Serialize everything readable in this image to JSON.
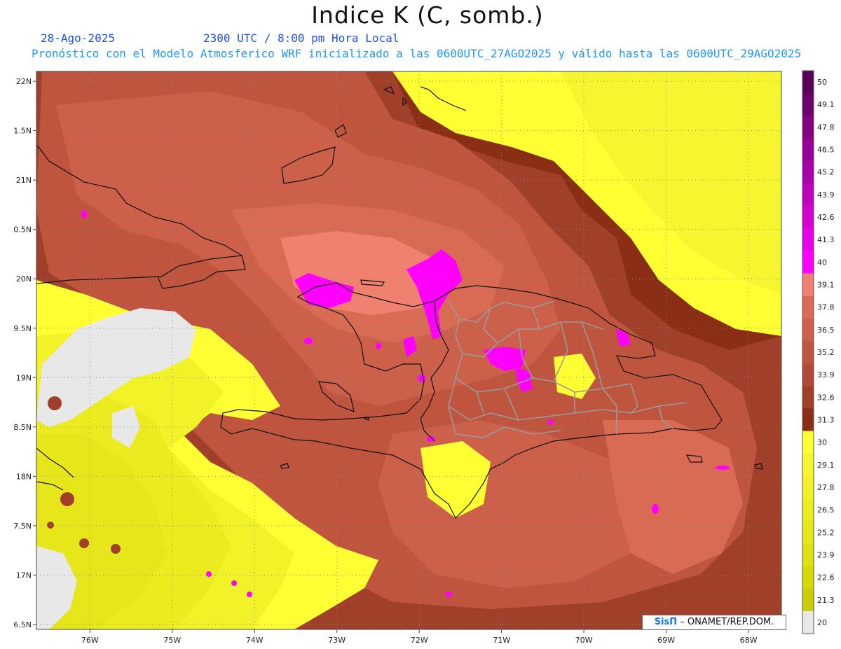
{
  "header": {
    "title": "Indice K (C, somb.)",
    "date": "28-Ago-2025",
    "time": "2300 UTC / 8:00 pm Hora Local",
    "description": "Pronóstico con el Modelo Atmosferico WRF inicializado a las 0600UTC_27AGO2025 y válido hasta las  0600UTC_29AGO2025"
  },
  "map": {
    "lon_range": [
      -76.65,
      -67.6
    ],
    "lat_range": [
      16.45,
      22.1
    ],
    "lat_ticks": [
      {
        "value": 22.0,
        "label": "22N"
      },
      {
        "value": 21.5,
        "label": "1.5N"
      },
      {
        "value": 21.0,
        "label": "21N"
      },
      {
        "value": 20.5,
        "label": "0.5N"
      },
      {
        "value": 20.0,
        "label": "20N"
      },
      {
        "value": 19.5,
        "label": "9.5N"
      },
      {
        "value": 19.0,
        "label": "19N"
      },
      {
        "value": 18.5,
        "label": "8.5N"
      },
      {
        "value": 18.0,
        "label": "18N"
      },
      {
        "value": 17.5,
        "label": "7.5N"
      },
      {
        "value": 17.0,
        "label": "17N"
      },
      {
        "value": 16.5,
        "label": "6.5N"
      }
    ],
    "lon_ticks": [
      {
        "value": -76,
        "label": "76W"
      },
      {
        "value": -75,
        "label": "75W"
      },
      {
        "value": -74,
        "label": "74W"
      },
      {
        "value": -73,
        "label": "73W"
      },
      {
        "value": -72,
        "label": "72W"
      },
      {
        "value": -71,
        "label": "71W"
      },
      {
        "value": -70,
        "label": "70W"
      },
      {
        "value": -69,
        "label": "69W"
      },
      {
        "value": -68,
        "label": "68W"
      }
    ],
    "colors": {
      "c20": "#cccc00",
      "c21": "#d9d900",
      "c22": "#e0e010",
      "c24": "#e6e61a",
      "c25": "#ebeb20",
      "c26": "#f2f228",
      "c28": "#f5f530",
      "c29": "#ffff33",
      "c31": "#8b2e16",
      "c33": "#a0402a",
      "c34": "#b04a35",
      "c35": "#c0553f",
      "c37": "#cc604a",
      "c38": "#d96b55",
      "c39": "#f08070",
      "c40": "#ff00ff",
      "c45": "#cc00cc",
      "c50": "#660066",
      "nodata": "#e8e8e8",
      "border": "#111111",
      "province": "#9a9a9a"
    }
  },
  "colorbar": {
    "labels": [
      "50",
      "49.1",
      "47.8",
      "46.5",
      "45.2",
      "43.9",
      "42.6",
      "41.3",
      "40",
      "39.1",
      "37.8",
      "36.5",
      "35.2",
      "33.9",
      "32.6",
      "31.3",
      "30",
      "29.1",
      "27.8",
      "26.5",
      "25.2",
      "23.9",
      "22.6",
      "21.3",
      "20"
    ],
    "swatches": [
      "#5a005a",
      "#6e006e",
      "#820082",
      "#960096",
      "#aa00aa",
      "#c000c0",
      "#d400d4",
      "#e800e8",
      "#ff00ff",
      "#f08070",
      "#d96b55",
      "#cc604a",
      "#c0553f",
      "#b04a35",
      "#a0402a",
      "#8b2e16",
      "#ffff33",
      "#f5f530",
      "#f2f228",
      "#ebeb20",
      "#e6e61a",
      "#e0e010",
      "#d9d900",
      "#cccc00",
      "#e8e8e8"
    ]
  },
  "credit": {
    "brand": "SisΠ",
    "text": "– ONAMET/REP.DOM."
  }
}
